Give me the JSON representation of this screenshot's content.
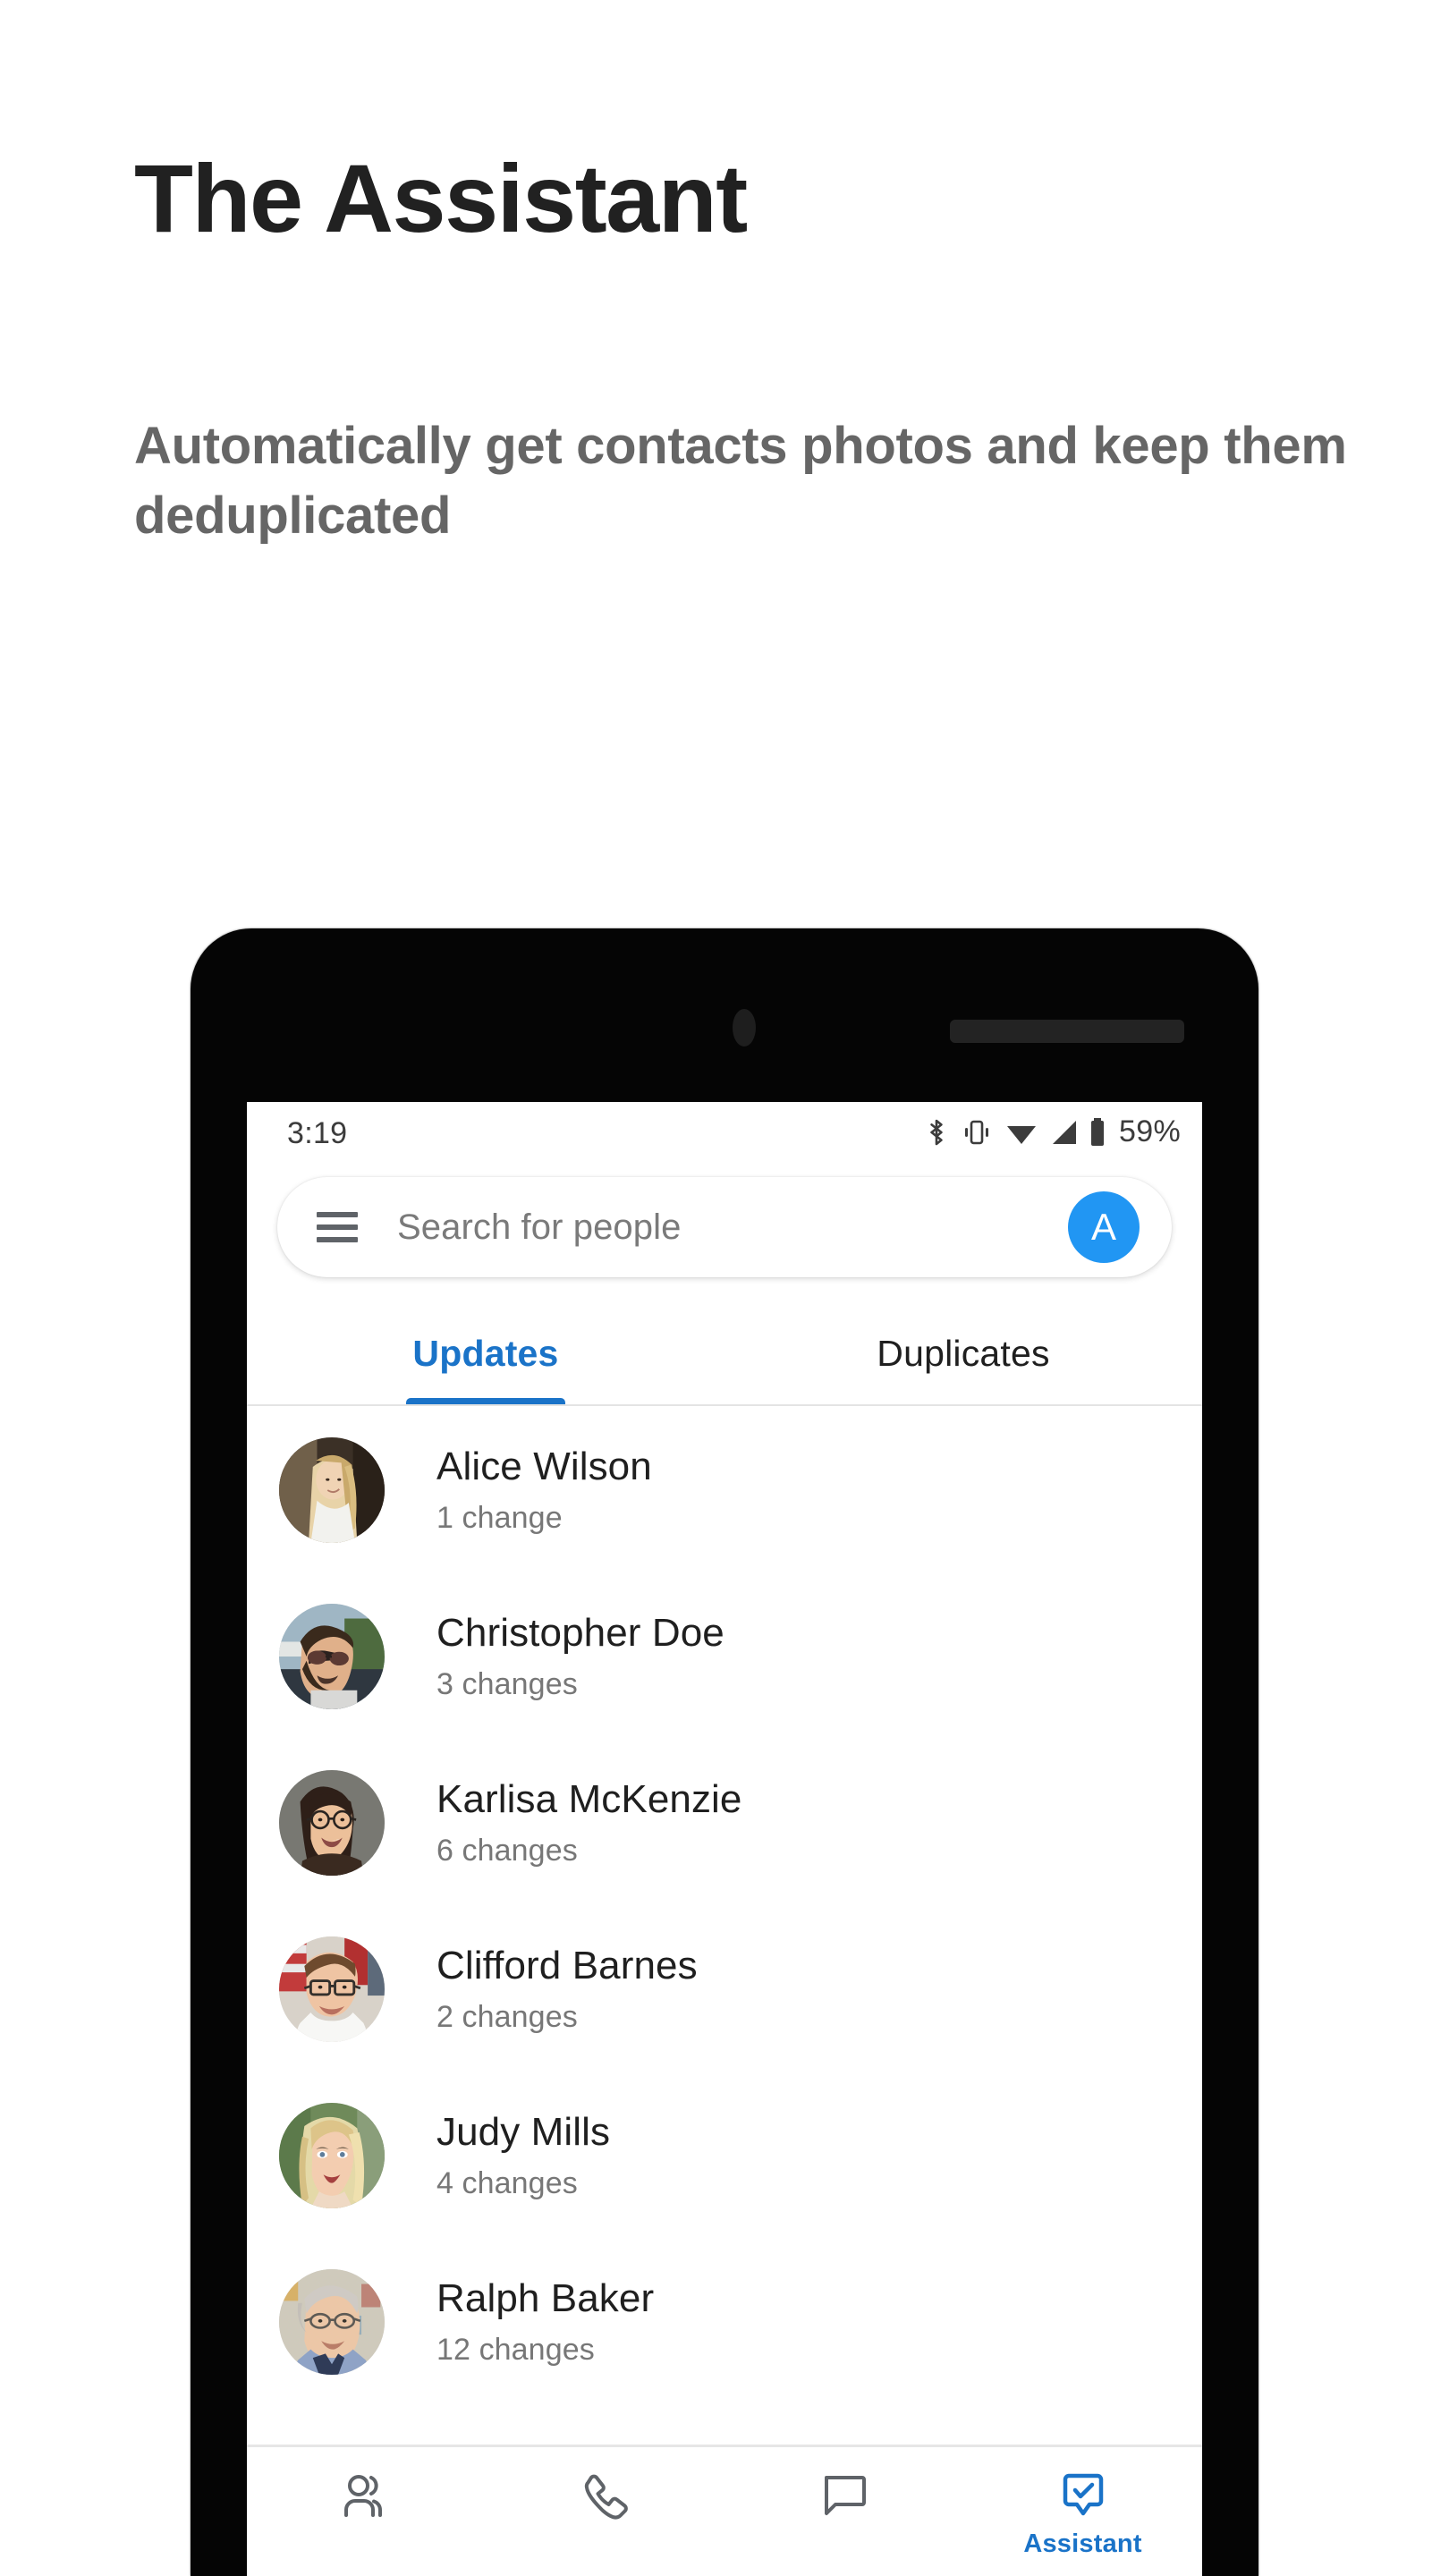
{
  "promo": {
    "title": "The Assistant",
    "subtitle": "Automatically get contacts photos and keep them deduplicated"
  },
  "phone": {
    "statusbar": {
      "time": "3:19",
      "battery_percent": "59%",
      "icons": [
        "bluetooth-icon",
        "vibrate-icon",
        "wifi-icon",
        "cellular-signal-icon",
        "battery-icon"
      ]
    },
    "searchbar": {
      "menu_icon": "hamburger-menu-icon",
      "placeholder": "Search for people",
      "avatar_initial": "A",
      "avatar_color": "#2196f3"
    },
    "tabs": {
      "items": [
        {
          "label": "Updates",
          "active": true
        },
        {
          "label": "Duplicates",
          "active": false
        }
      ],
      "active_color": "#1a73c8"
    },
    "contacts": [
      {
        "name": "Alice Wilson",
        "changes": "1 change",
        "photo": "woman-blonde-outdoors"
      },
      {
        "name": "Christopher Doe",
        "changes": "3 changes",
        "photo": "man-sunglasses-beard"
      },
      {
        "name": "Karlisa McKenzie",
        "changes": "6 changes",
        "photo": "woman-glasses-smiling"
      },
      {
        "name": "Clifford Barnes",
        "changes": "2 changes",
        "photo": "man-glasses-white-shirt"
      },
      {
        "name": "Judy Mills",
        "changes": "4 changes",
        "photo": "woman-blonde-portrait"
      },
      {
        "name": "Ralph Baker",
        "changes": "12 changes",
        "photo": "older-man-glasses-blue-shirt"
      }
    ],
    "bottomnav": {
      "items": [
        {
          "icon": "contacts-people-icon",
          "label": "",
          "active": false
        },
        {
          "icon": "phone-handset-icon",
          "label": "",
          "active": false
        },
        {
          "icon": "message-bubble-icon",
          "label": "",
          "active": false
        },
        {
          "icon": "assistant-check-bubble-icon",
          "label": "Assistant",
          "active": true
        }
      ],
      "inactive_color": "#5f6368",
      "active_color": "#1a73c8"
    }
  }
}
